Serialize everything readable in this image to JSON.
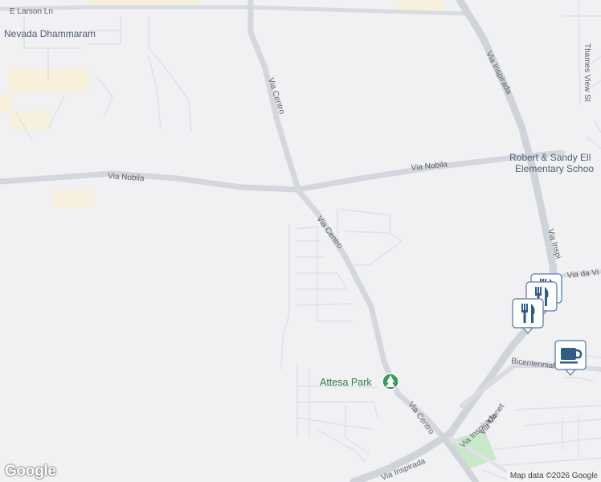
{
  "map": {
    "background_color": "#f1f0f2",
    "road_color": "#dfe2e8",
    "highway_color": "#cfd3da",
    "park_color": "#c7e9c9",
    "logo": "Google",
    "attribution": "Map data ©2026 Google"
  },
  "labels": {
    "e_larson_ln": "E Larson Ln",
    "nevada_dhammaram": "Nevada Dhammaram",
    "via_centro_north": "Via Centro",
    "via_inspirada_north": "Via Inspirada",
    "thames_view_st": "Thames View St",
    "via_nobila_west": "Via Nobila",
    "via_nobila_east": "Via Nobila",
    "robert_sandy_line1": "Robert & Sandy Ell",
    "robert_sandy_line2": "Elementary Schoo",
    "via_centro_mid": "Via Centro",
    "via_inspirada_east": "Via Inspi",
    "via_da_vi": "Via da Vi",
    "bicentennial_pkwy": "Bicentennial Pkwy",
    "attesa_park": "Attesa Park",
    "via_centro_south": "Via Centro",
    "via_inspirada_southwest": "Via Inspirada",
    "via_inspirada_south": "Via Inspirada",
    "via_monet": "Via Monet",
    "via_south_edge": "ira"
  },
  "markers": [
    {
      "name": "restaurant-marker-1",
      "icon": "fork-knife-icon",
      "color": "#2f5d86"
    },
    {
      "name": "restaurant-marker-2",
      "icon": "fork-knife-icon",
      "color": "#2f5d86"
    },
    {
      "name": "restaurant-marker-3",
      "icon": "fork-knife-icon",
      "color": "#2f5d86"
    },
    {
      "name": "cafe-marker",
      "icon": "coffee-cup-icon",
      "color": "#2f5d86"
    },
    {
      "name": "park-marker",
      "icon": "tree-icon",
      "color": "#3a9a5b"
    }
  ]
}
